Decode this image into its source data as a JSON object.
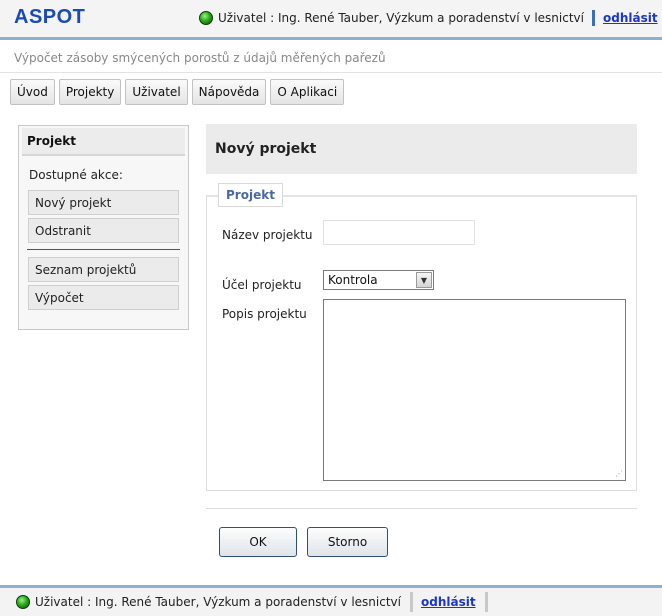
{
  "app": {
    "logo": "ASPOT",
    "subtitle": "Výpočet zásoby smýcených porostů z údajů měřených pařezů"
  },
  "user": {
    "label": "Uživatel : Ing. René Tauber, Výzkum a poradenství v lesnictví",
    "logout": "odhlásit"
  },
  "nav": [
    {
      "label": "Úvod"
    },
    {
      "label": "Projekty"
    },
    {
      "label": "Uživatel"
    },
    {
      "label": "Nápověda"
    },
    {
      "label": "O Aplikaci"
    }
  ],
  "sidebar": {
    "title": "Projekt",
    "actions_label": "Dostupné akce:",
    "items": [
      {
        "label": "Nový projekt"
      },
      {
        "label": "Odstranit"
      },
      {
        "label": "Seznam projektů"
      },
      {
        "label": "Výpočet"
      }
    ]
  },
  "main": {
    "title": "Nový projekt",
    "legend": "Projekt",
    "fields": {
      "name_label": "Název projektu",
      "name_value": "",
      "purpose_label": "Účel projektu",
      "purpose_value": "Kontrola",
      "description_label": "Popis projektu",
      "description_value": ""
    },
    "buttons": {
      "ok": "OK",
      "cancel": "Storno"
    }
  },
  "colors": {
    "logo": "#1a4bb5",
    "link": "#1b36c9",
    "accent_border": "#8fb0cc",
    "status": "#2eaa1c"
  },
  "icons": {
    "status": "online-status-icon",
    "select_arrow": "chevron-down-icon"
  }
}
